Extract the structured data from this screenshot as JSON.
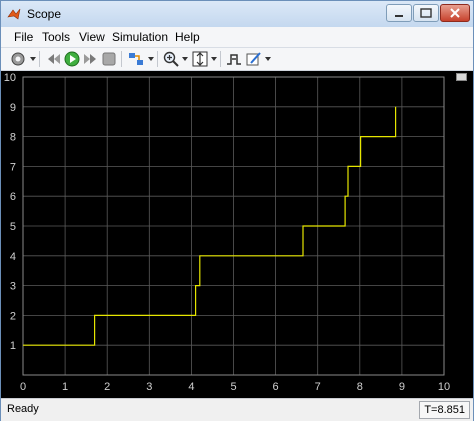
{
  "window": {
    "title": "Scope"
  },
  "menu": [
    "File",
    "Tools",
    "View",
    "Simulation",
    "Help"
  ],
  "toolbar": [
    "gear-icon",
    "step-back-icon",
    "run-icon",
    "step-forward-icon",
    "stop-icon",
    "highlight-icon",
    "zoom-in-icon",
    "autoscale-icon",
    "triggers-icon",
    "style-icon"
  ],
  "status": {
    "text": "Ready",
    "time": "T=8.851"
  },
  "chart_data": {
    "type": "line",
    "title": "",
    "xlabel": "",
    "ylabel": "",
    "xlim": [
      0,
      10
    ],
    "ylim": [
      0,
      10
    ],
    "grid": true,
    "x_ticks": [
      "0",
      "1",
      "2",
      "3",
      "4",
      "5",
      "6",
      "7",
      "8",
      "9",
      "10"
    ],
    "y_ticks": [
      "1",
      "2",
      "3",
      "4",
      "5",
      "6",
      "7",
      "8",
      "9",
      "10"
    ],
    "line_color": "#e6e600",
    "series": [
      {
        "x": [
          0,
          1.7,
          1.7,
          4.1,
          4.1,
          4.2,
          4.2,
          6.65,
          6.65,
          7.65,
          7.65,
          7.72,
          7.72,
          8.02,
          8.02,
          8.85,
          8.85
        ],
        "y": [
          1,
          1,
          2,
          2,
          3,
          3,
          4,
          4,
          5,
          5,
          6,
          6,
          7,
          7,
          8,
          8,
          9
        ]
      }
    ]
  }
}
